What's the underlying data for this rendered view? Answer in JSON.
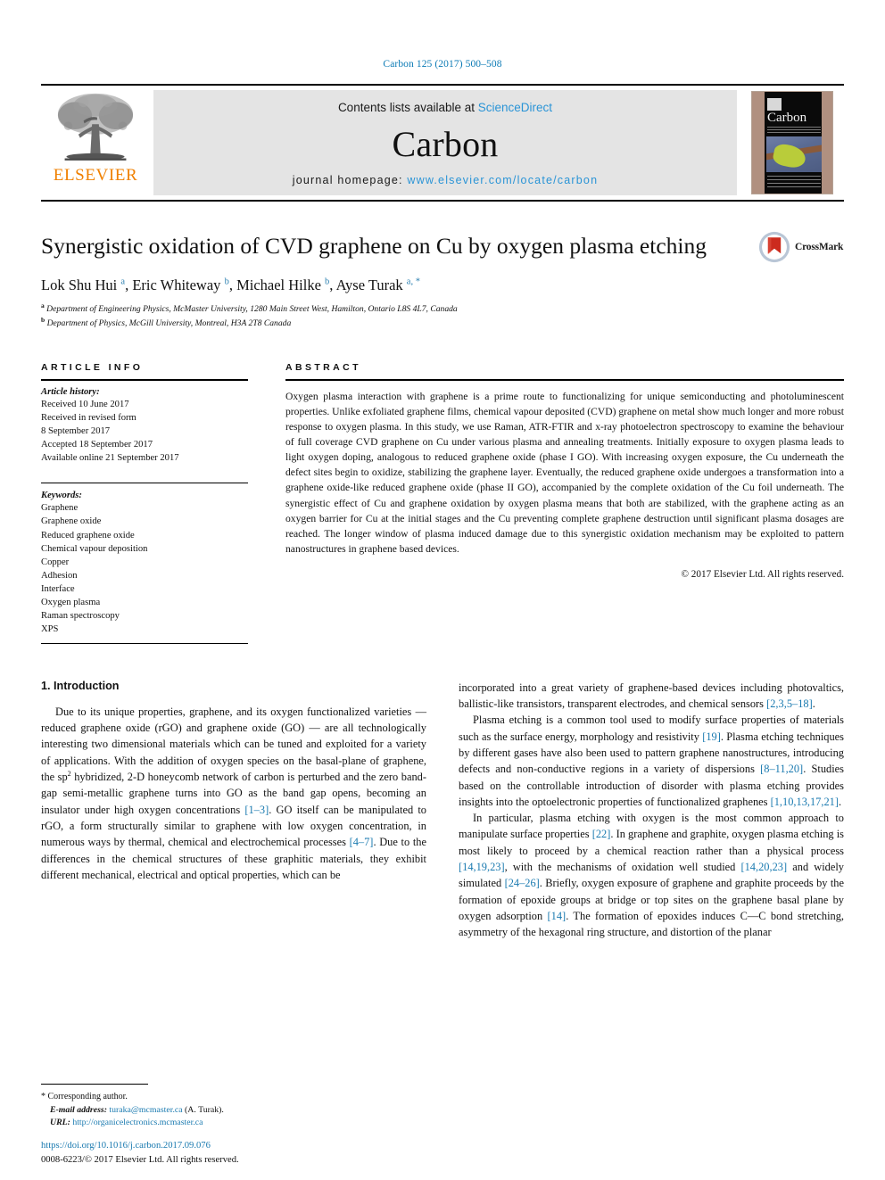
{
  "running_head": "Carbon 125 (2017) 500–508",
  "masthead": {
    "contents_prefix": "Contents lists available at ",
    "sciencedirect": "ScienceDirect",
    "journal_name": "Carbon",
    "homepage_prefix": "journal homepage: ",
    "homepage_url": "www.elsevier.com/locate/carbon",
    "elsevier_wordmark": "ELSEVIER",
    "cover_title": "Carbon",
    "link_color": "#2a94d6",
    "elsevier_orange": "#f08000"
  },
  "article": {
    "title": "Synergistic oxidation of CVD graphene on Cu by oxygen plasma etching",
    "authors_html": "Lok Shu Hui <sup>a</sup>, Eric Whiteway <sup>b</sup>, Michael Hilke <sup>b</sup>, Ayse Turak <sup>a, *</sup>",
    "affiliation_a": "Department of Engineering Physics, McMaster University, 1280 Main Street West, Hamilton, Ontario L8S 4L7, Canada",
    "affiliation_b": "Department of Physics, McGill University, Montreal, H3A 2T8 Canada",
    "crossmark_label": "CrossMark"
  },
  "sections": {
    "article_info_heading": "ARTICLE INFO",
    "abstract_heading": "ABSTRACT"
  },
  "article_history": {
    "label": "Article history:",
    "lines": [
      "Received 10 June 2017",
      "Received in revised form",
      "8 September 2017",
      "Accepted 18 September 2017",
      "Available online 21 September 2017"
    ]
  },
  "keywords": {
    "label": "Keywords:",
    "items": [
      "Graphene",
      "Graphene oxide",
      "Reduced graphene oxide",
      "Chemical vapour deposition",
      "Copper",
      "Adhesion",
      "Interface",
      "Oxygen plasma",
      "Raman spectroscopy",
      "XPS"
    ]
  },
  "abstract": {
    "text": "Oxygen plasma interaction with graphene is a prime route to functionalizing for unique semiconducting and photoluminescent properties. Unlike exfoliated graphene films, chemical vapour deposited (CVD) graphene on metal show much longer and more robust response to oxygen plasma. In this study, we use Raman, ATR-FTIR and x-ray photoelectron spectroscopy to examine the behaviour of full coverage CVD graphene on Cu under various plasma and annealing treatments. Initially exposure to oxygen plasma leads to light oxygen doping, analogous to reduced graphene oxide (phase I GO). With increasing oxygen exposure, the Cu underneath the defect sites begin to oxidize, stabilizing the graphene layer. Eventually, the reduced graphene oxide undergoes a transformation into a graphene oxide-like reduced graphene oxide (phase II GO), accompanied by the complete oxidation of the Cu foil underneath. The synergistic effect of Cu and graphene oxidation by oxygen plasma means that both are stabilized, with the graphene acting as an oxygen barrier for Cu at the initial stages and the Cu preventing complete graphene destruction until significant plasma dosages are reached. The longer window of plasma induced damage due to this synergistic oxidation mechanism may be exploited to pattern nanostructures in graphene based devices.",
    "copyright": "© 2017 Elsevier Ltd. All rights reserved."
  },
  "introduction": {
    "heading": "1. Introduction",
    "left_paragraph_1_html": "Due to its unique properties, graphene, and its oxygen functionalized varieties — reduced graphene oxide (rGO) and graphene oxide (GO) — are all technologically interesting two dimensional materials which can be tuned and exploited for a variety of applications. With the addition of oxygen species on the basal-plane of graphene, the sp<sup class=\"sp\">2</sup> hybridized, 2-D honeycomb network of carbon is perturbed and the zero band-gap semi-metallic graphene turns into GO as the band gap opens, becoming an insulator under high oxygen concentrations <span class=\"ref\">[1&ndash;3]</span>. GO itself can be manipulated to rGO, a form structurally similar to graphene with low oxygen concentration, in numerous ways by thermal, chemical and electrochemical processes <span class=\"ref\">[4&ndash;7]</span>. Due to the differences in the chemical structures of these graphitic materials, they exhibit different mechanical, electrical and optical properties, which can be",
    "right_paragraph_1_html": "incorporated into a great variety of graphene-based devices including photovaltics, ballistic-like transistors, transparent electrodes, and chemical sensors <span class=\"ref\">[2,3,5&ndash;18]</span>.",
    "right_paragraph_2_html": "Plasma etching is a common tool used to modify surface properties of materials such as the surface energy, morphology and resistivity <span class=\"ref\">[19]</span>. Plasma etching techniques by different gases have also been used to pattern graphene nanostructures, introducing defects and non-conductive regions in a variety of dispersions <span class=\"ref\">[8&ndash;11,20]</span>. Studies based on the controllable introduction of disorder with plasma etching provides insights into the optoelectronic properties of functionalized graphenes <span class=\"ref\">[1,10,13,17,21]</span>.",
    "right_paragraph_3_html": "In particular, plasma etching with oxygen is the most common approach to manipulate surface properties <span class=\"ref\">[22]</span>. In graphene and graphite, oxygen plasma etching is most likely to proceed by a chemical reaction rather than a physical process <span class=\"ref\">[14,19,23]</span>, with the mechanisms of oxidation well studied <span class=\"ref\">[14,20,23]</span> and widely simulated <span class=\"ref\">[24&ndash;26]</span>. Briefly, oxygen exposure of graphene and graphite proceeds by the formation of epoxide groups at bridge or top sites on the graphene basal plane by oxygen adsorption <span class=\"ref\">[14]</span>. The formation of epoxides induces C—C bond stretching, asymmetry of the hexagonal ring structure, and distortion of the planar"
  },
  "footnote": {
    "corresponding": "* Corresponding author.",
    "email_label": "E-mail address:",
    "email": "turaka@mcmaster.ca",
    "email_suffix": "(A. Turak).",
    "url_label": "URL:",
    "url": "http://organicelectronics.mcmaster.ca",
    "doi": "https://doi.org/10.1016/j.carbon.2017.09.076",
    "issn_line": "0008-6223/© 2017 Elsevier Ltd. All rights reserved."
  }
}
